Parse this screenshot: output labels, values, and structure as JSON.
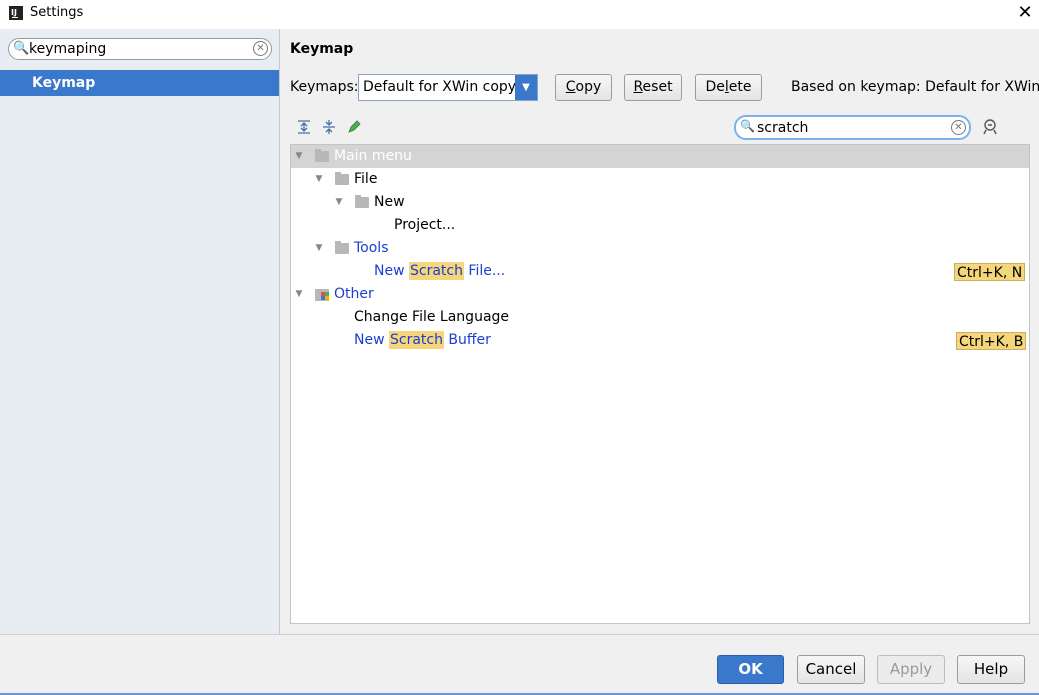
{
  "window": {
    "title": "Settings",
    "app_icon_text": "IJ",
    "close_glyph": "✕"
  },
  "sidebar": {
    "search_value": "keymaping",
    "items": [
      {
        "label": "Keymap",
        "selected": true
      }
    ]
  },
  "panel": {
    "title": "Keymap",
    "keymaps_label": "Keymaps:",
    "keymap_selected": "Default for XWin copy",
    "buttons": {
      "copy": "Copy",
      "reset": "Reset",
      "delete_pre": "De",
      "delete_ul": "l",
      "delete_post": "ete",
      "copy_ul": "C",
      "copy_rest": "opy",
      "reset_ul": "R",
      "reset_rest": "eset"
    },
    "based_on": "Based on keymap: Default for XWin",
    "filter_value": "scratch",
    "toolbar_icons": [
      "expand-all-icon",
      "collapse-all-icon",
      "edit-shortcut-icon"
    ]
  },
  "tree": {
    "rows": [
      {
        "label": "Main menu",
        "depth": 0,
        "expanded": true,
        "icon": "folder-icon",
        "selected": true
      },
      {
        "label": "File",
        "depth": 1,
        "expanded": true,
        "icon": "folder-icon"
      },
      {
        "label": "New",
        "depth": 2,
        "expanded": true,
        "icon": "folder-icon"
      },
      {
        "label": "Project...",
        "depth": 3
      },
      {
        "label": "Tools",
        "depth": 1,
        "expanded": true,
        "icon": "folder-icon"
      },
      {
        "label_pre": "New ",
        "label_hl": "Scratch",
        "label_post": " File...",
        "depth": 3,
        "shortcut": "Ctrl+K, N"
      },
      {
        "label": "Other",
        "depth": 0,
        "expanded": true,
        "icon": "other-folder-icon"
      },
      {
        "label": "Change File Language",
        "depth": 2
      },
      {
        "label_pre": "New ",
        "label_hl": "Scratch",
        "label_post": " Buffer",
        "depth": 2,
        "shortcut": "Ctrl+K, B"
      }
    ]
  },
  "footer": {
    "ok": "OK",
    "cancel": "Cancel",
    "apply": "Apply",
    "help": "Help"
  },
  "colors": {
    "accent": "#3a78cc",
    "highlight": "#f5d67a",
    "link_blue": "#1a3fd0"
  }
}
